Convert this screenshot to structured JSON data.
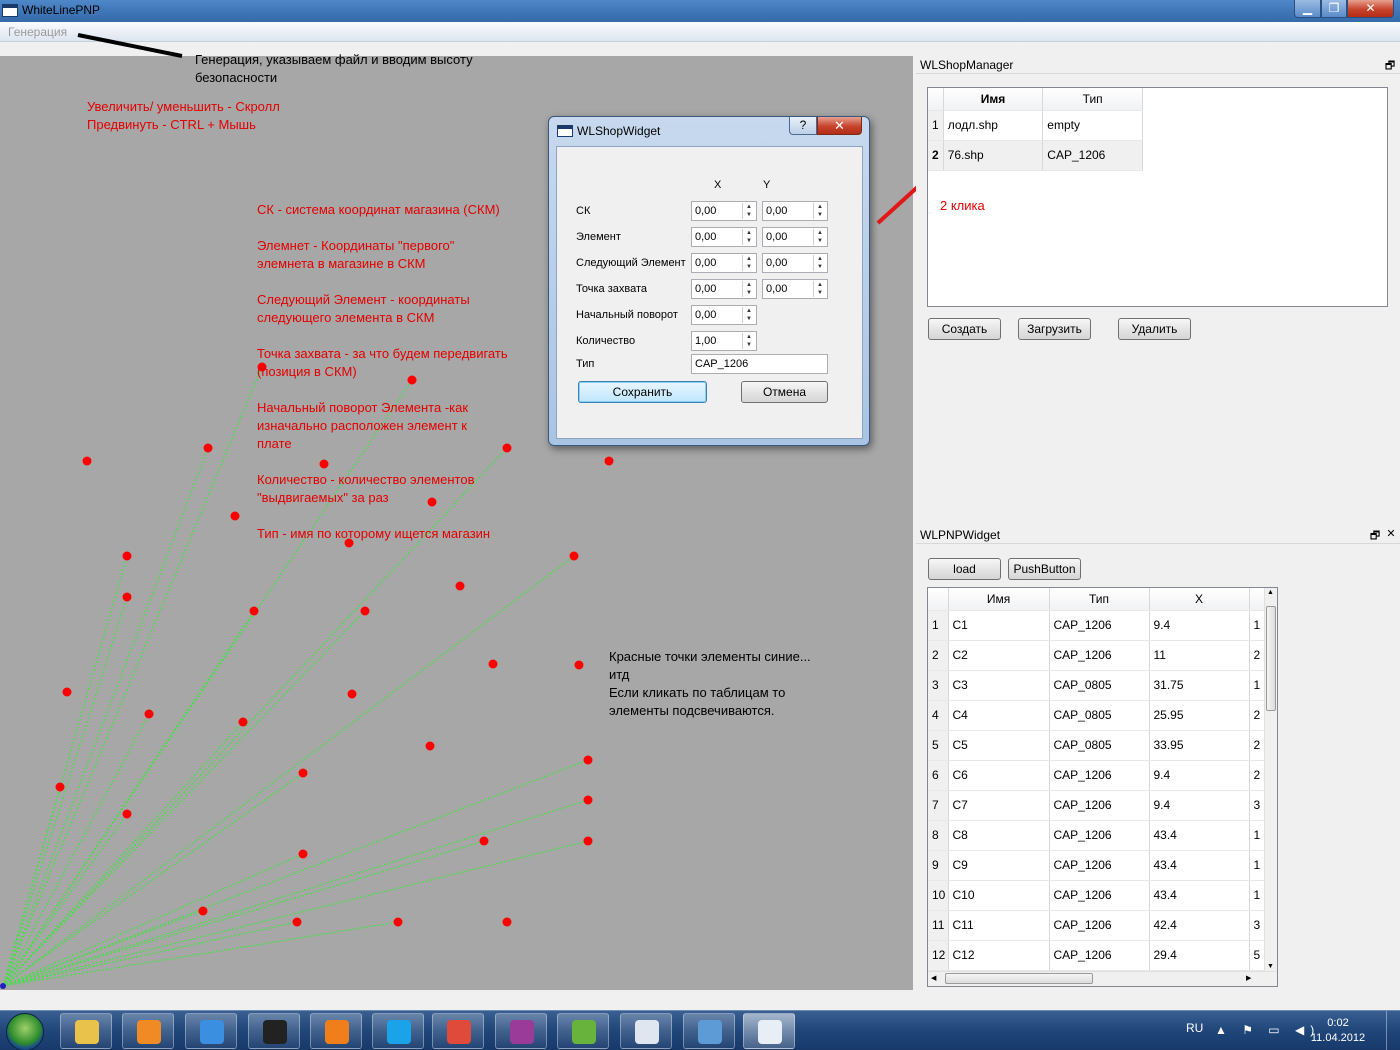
{
  "window": {
    "title": "WhiteLinePNP",
    "controls": {
      "minimize": "▁",
      "maximize": "❐",
      "close": "✕"
    }
  },
  "menubar": {
    "items": [
      "Генерация"
    ]
  },
  "canvas": {
    "background": "#a7a7a7",
    "dot_color": "#ff0000",
    "line_color": "#46e046",
    "notes": {
      "generation": "Генерация, указываем файл и вводим высоту\nбезопасности",
      "zoom": "Увеличить/ уменьшить - Скролл\nПредвинуть - CTRL + Мышь",
      "sk": "СК - система координат магазина (СКМ)",
      "element": "Элемнет - Координаты \"первого\"\nэлемнета в магазине в СКМ",
      "next": "Следующий Элемент - координаты\nследующего элемента в СКМ",
      "grip": "Точка захвата - за что будем передвигать\n(позиция в СКМ)",
      "rotation": "Начальный поворот Элемента -как\nизначально расположен элемент к\nплате",
      "count": "Количество - количество элементов\n\"выдвигаемых\" за раз",
      "type": "Тип - имя по которому ищется магазин",
      "dots": "Красные точки элементы синие...\nитд\nЕсли кликать по таблицам то\nэлементы подсвечиваются.",
      "clicks": "2 клика"
    }
  },
  "shop_manager": {
    "title": "WLShopManager",
    "float_icon": "🗗",
    "columns": [
      "Имя",
      "Тип"
    ],
    "rows": [
      {
        "n": "1",
        "name": "лодл.shp",
        "type": "empty"
      },
      {
        "n": "2",
        "name": "76.shp",
        "type": "CAP_1206"
      }
    ],
    "buttons": {
      "create": "Создать",
      "load": "Загрузить",
      "delete": "Удалить"
    }
  },
  "pnp_widget": {
    "title": "WLPNPWidget",
    "float_icon": "🗗",
    "close_icon": "✕",
    "buttons": {
      "load": "load",
      "push": "PushButton"
    },
    "columns": [
      "Имя",
      "Тип",
      "X"
    ],
    "rows": [
      {
        "n": "1",
        "name": "C1",
        "type": "CAP_1206",
        "x": "9.4",
        "y": "1"
      },
      {
        "n": "2",
        "name": "C2",
        "type": "CAP_1206",
        "x": "11",
        "y": "2"
      },
      {
        "n": "3",
        "name": "C3",
        "type": "CAP_0805",
        "x": "31.75",
        "y": "1"
      },
      {
        "n": "4",
        "name": "C4",
        "type": "CAP_0805",
        "x": "25.95",
        "y": "2"
      },
      {
        "n": "5",
        "name": "C5",
        "type": "CAP_0805",
        "x": "33.95",
        "y": "2"
      },
      {
        "n": "6",
        "name": "C6",
        "type": "CAP_1206",
        "x": "9.4",
        "y": "2"
      },
      {
        "n": "7",
        "name": "C7",
        "type": "CAP_1206",
        "x": "9.4",
        "y": "3"
      },
      {
        "n": "8",
        "name": "C8",
        "type": "CAP_1206",
        "x": "43.4",
        "y": "1"
      },
      {
        "n": "9",
        "name": "C9",
        "type": "CAP_1206",
        "x": "43.4",
        "y": "1"
      },
      {
        "n": "10",
        "name": "C10",
        "type": "CAP_1206",
        "x": "43.4",
        "y": "1"
      },
      {
        "n": "11",
        "name": "C11",
        "type": "CAP_1206",
        "x": "42.4",
        "y": "3"
      },
      {
        "n": "12",
        "name": "C12",
        "type": "CAP_1206",
        "x": "29.4",
        "y": "5"
      }
    ]
  },
  "dialog": {
    "title": "WLShopWidget",
    "help": "?",
    "close": "✕",
    "col_x": "X",
    "col_y": "Y",
    "fields": [
      {
        "label": "СК",
        "x": "0,00",
        "y": "0,00"
      },
      {
        "label": "Элемент",
        "x": "0,00",
        "y": "0,00"
      },
      {
        "label": "Следующий Элемент",
        "x": "0,00",
        "y": "0,00"
      },
      {
        "label": "Точка захвата",
        "x": "0,00",
        "y": "0,00"
      },
      {
        "label": "Начальный поворот",
        "x": "0,00"
      },
      {
        "label": "Количество",
        "x": "1,00"
      }
    ],
    "type_label": "Тип",
    "type_value": "CAP_1206",
    "save": "Сохранить",
    "cancel": "Отмена"
  },
  "taskbar": {
    "items": [
      "explorer-icon",
      "media-player-icon",
      "internet-explorer-icon",
      "game-icon",
      "vlc-icon",
      "skype-icon",
      "chrome-icon",
      "winrar-icon",
      "qt-creator-icon",
      "wordpad-icon",
      "control-panel-icon",
      "whitelinepnp-icon"
    ],
    "language": "RU",
    "time": "0:02",
    "date": "11.04.2012"
  }
}
